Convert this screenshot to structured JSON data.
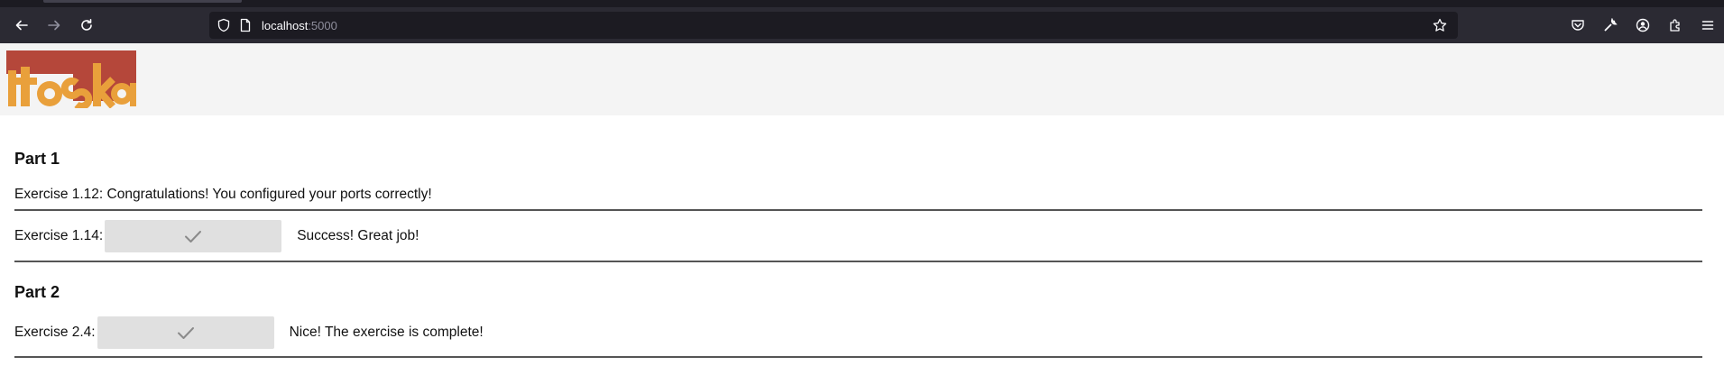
{
  "browser": {
    "url_host": "localhost",
    "url_port": ":5000",
    "icons": [
      "back-arrow-icon",
      "forward-arrow-icon",
      "reload-icon",
      "shield-icon",
      "page-icon",
      "star-icon",
      "pocket-icon",
      "wrench-icon",
      "account-icon",
      "extensions-icon",
      "menu-icon"
    ]
  },
  "site": {
    "logo_text": "itoska",
    "logo_colors": {
      "red": "#b5473a",
      "orange": "#e9a03b"
    }
  },
  "parts": [
    {
      "title": "Part 1",
      "exercises": [
        {
          "label": "Exercise 1.12: Congratulations! You configured your ports correctly!"
        },
        {
          "label": "Exercise 1.14:",
          "button_icon": "checkmark-icon",
          "message": "Success! Great job!"
        }
      ]
    },
    {
      "title": "Part 2",
      "exercises": [
        {
          "label": "Exercise 2.4:",
          "button_icon": "checkmark-icon",
          "message": "Nice! The exercise is complete!"
        }
      ]
    }
  ],
  "colors": {
    "chrome_dark": "#1c1b22",
    "toolbar": "#2b2a33",
    "header_bg": "#f4f4f4",
    "button_bg": "#e0e0e0",
    "rule": "#555555"
  }
}
